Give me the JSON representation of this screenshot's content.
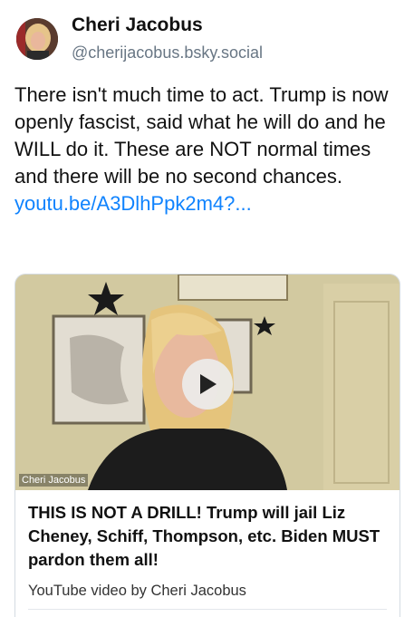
{
  "author": {
    "name": "Cheri Jacobus",
    "handle": "@cherijacobus.bsky.social"
  },
  "post": {
    "text": "There isn't much time to act. Trump is now openly fascist, said what he will do and he WILL do it. These are NOT normal times and there will be no second chances.",
    "link": "youtu.be/A3DlhPpk2m4?..."
  },
  "embed": {
    "thumbnail_label": "Cheri Jacobus",
    "title": "THIS IS NOT A DRILL! Trump will jail Liz Cheney, Schiff, Thompson, etc. Biden MUST pardon them all!",
    "description": "YouTube video by Cheri Jacobus"
  },
  "colors": {
    "link": "#1083fe",
    "handle": "#687684"
  }
}
